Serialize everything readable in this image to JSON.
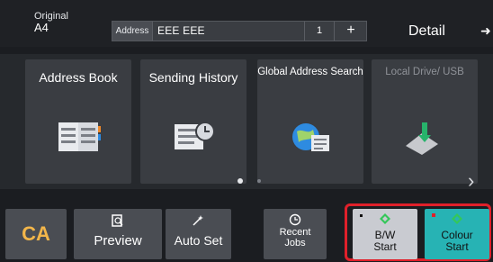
{
  "topbar": {
    "original_label": "Original",
    "original_size": "A4",
    "address_label": "Address",
    "address_value": "EEE EEE",
    "address_count": "1",
    "add_icon": "plus",
    "detail_label": "Detail",
    "detail_icon": "arrow-right"
  },
  "tiles": [
    {
      "label": "Address Book",
      "icon": "address-book-icon",
      "enabled": true
    },
    {
      "label": "Sending History",
      "icon": "sending-history-icon",
      "enabled": true
    },
    {
      "label": "Global Address Search",
      "icon": "global-address-search-icon",
      "enabled": true
    },
    {
      "label": "Local Drive/ USB",
      "icon": "local-drive-usb-icon",
      "enabled": false
    }
  ],
  "pager": {
    "pages": 2,
    "current": 1,
    "next_icon": "chevron-right"
  },
  "bottom": {
    "ca_label": "CA",
    "preview_label": "Preview",
    "preview_icon": "preview-icon",
    "autoset_label": "Auto Set",
    "autoset_icon": "auto-set-icon",
    "recent_label": "Recent Jobs",
    "recent_icon": "recent-jobs-icon",
    "bw_label": "B/W Start",
    "colour_label": "Colour Start",
    "start_icon": "start-diamond-icon"
  },
  "colors": {
    "background": "#1b1d21",
    "tile": "#3a3d42",
    "ca_text": "#f3b64a",
    "bw_button": "#c9cbd1",
    "colour_button": "#27b3b4",
    "start_diamond": "#34c759",
    "highlight_border": "#e0202a"
  }
}
